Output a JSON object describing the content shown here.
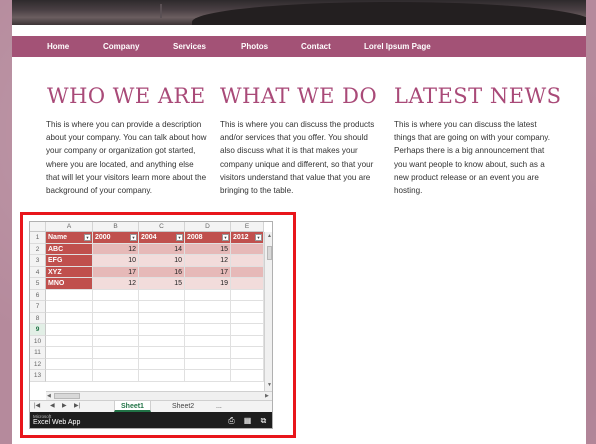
{
  "nav": {
    "items": [
      "Home",
      "Company",
      "Services",
      "Photos",
      "Contact",
      "Lorel Ipsum Page"
    ]
  },
  "columns": [
    {
      "title": "WHO WE ARE",
      "text": "This is where you can provide a description about your company.  You can talk about how your company or organization got started, where you are located, and anything else that will let your visitors learn more about the background of your company."
    },
    {
      "title": "WHAT WE DO",
      "text": "This is where you can discuss the products and/or services that you offer.  You should also discuss what it is that makes your company unique and different, so that your visitors understand that value that you are bringing to the table."
    },
    {
      "title": "LATEST NEWS",
      "text": "This is where you can discuss the latest things that are going on with your company.  Perhaps there is a big announcement that you want people to know about, such as a new product release or an event you are hosting."
    }
  ],
  "excel": {
    "col_letters": [
      "A",
      "B",
      "C",
      "D",
      "E"
    ],
    "row_numbers": [
      "1",
      "2",
      "3",
      "4",
      "5",
      "6",
      "7",
      "8",
      "9",
      "10",
      "11",
      "12",
      "13"
    ],
    "selected_row": "9",
    "headers": [
      "Name",
      "2000",
      "2004",
      "2008",
      "2012"
    ],
    "rows": [
      {
        "name": "ABC",
        "values": [
          "12",
          "14",
          "15",
          ""
        ]
      },
      {
        "name": "EFG",
        "values": [
          "10",
          "10",
          "12",
          ""
        ]
      },
      {
        "name": "XYZ",
        "values": [
          "17",
          "16",
          "17",
          ""
        ]
      },
      {
        "name": "MNO",
        "values": [
          "12",
          "15",
          "19",
          ""
        ]
      }
    ],
    "sheets": [
      "Sheet1",
      "Sheet2",
      "..."
    ],
    "active_sheet": "Sheet1",
    "brand_small": "Microsoft",
    "brand": "Excel Web App",
    "colors": {
      "header": "#c0504d",
      "band_light": "#f2dcdb",
      "band_dark": "#e6b9b8",
      "accent": "#217346",
      "frame": "#e8151b",
      "nav": "#a35276",
      "heading": "#a94a78"
    }
  }
}
